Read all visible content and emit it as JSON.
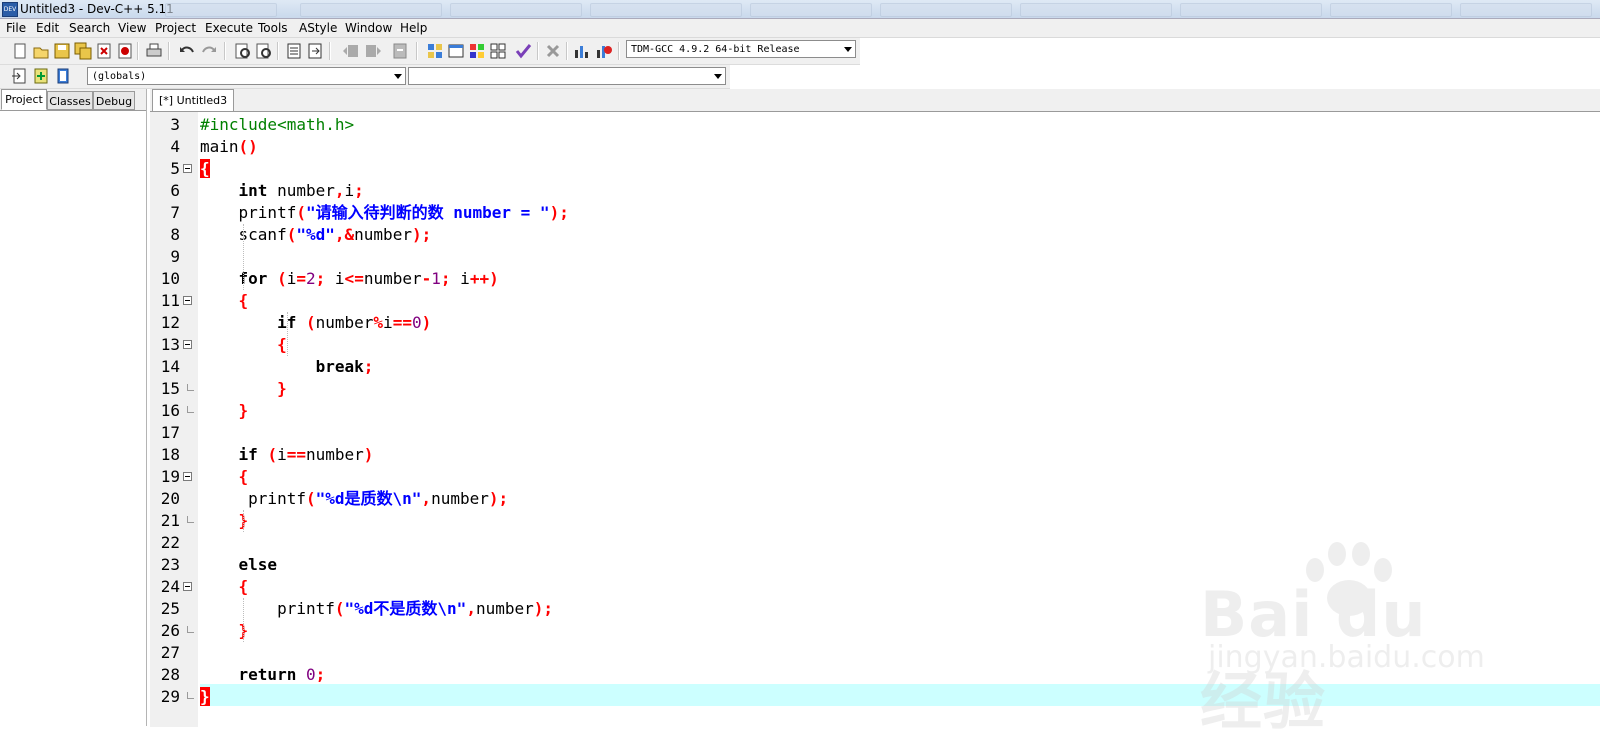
{
  "window": {
    "title": "Untitled3 - Dev-C++ 5.11"
  },
  "menu": [
    "File",
    "Edit",
    "Search",
    "View",
    "Project",
    "Execute",
    "Tools",
    "AStyle",
    "Window",
    "Help"
  ],
  "toolbar": {
    "compiler_select": "TDM-GCC 4.9.2 64-bit Release",
    "scope_select": "(globals)",
    "function_select": ""
  },
  "left_panel": {
    "tabs": [
      "Project",
      "Classes",
      "Debug"
    ],
    "active_tab": "Project"
  },
  "editor": {
    "tab_label": "[*] Untitled3",
    "current_line": 29,
    "lines": [
      {
        "n": "3",
        "text": "#include<math.h>"
      },
      {
        "n": "4",
        "text": "main()"
      },
      {
        "n": "5",
        "text": "{"
      },
      {
        "n": "6",
        "text": "    int number,i;"
      },
      {
        "n": "7",
        "text": "    printf(\"请输入待判断的数 number = \");"
      },
      {
        "n": "8",
        "text": "    scanf(\"%d\",&number);"
      },
      {
        "n": "9",
        "text": ""
      },
      {
        "n": "10",
        "text": "    for (i=2; i<=number-1; i++)"
      },
      {
        "n": "11",
        "text": "    {"
      },
      {
        "n": "12",
        "text": "        if (number%i==0)"
      },
      {
        "n": "13",
        "text": "        {"
      },
      {
        "n": "14",
        "text": "            break;"
      },
      {
        "n": "15",
        "text": "        }"
      },
      {
        "n": "16",
        "text": "    }"
      },
      {
        "n": "17",
        "text": ""
      },
      {
        "n": "18",
        "text": "    if (i==number)"
      },
      {
        "n": "19",
        "text": "    {"
      },
      {
        "n": "20",
        "text": "     printf(\"%d是质数\\n\",number);"
      },
      {
        "n": "21",
        "text": "    }"
      },
      {
        "n": "22",
        "text": ""
      },
      {
        "n": "23",
        "text": "    else"
      },
      {
        "n": "24",
        "text": "    {"
      },
      {
        "n": "25",
        "text": "        printf(\"%d不是质数\\n\",number);"
      },
      {
        "n": "26",
        "text": "    }"
      },
      {
        "n": "27",
        "text": ""
      },
      {
        "n": "28",
        "text": "    return 0;"
      },
      {
        "n": "29",
        "text": "}"
      }
    ]
  },
  "watermark": {
    "brand": "Bai du 经验",
    "url": "jingyan.baidu.com"
  },
  "colors": {
    "preprocessor": "#008000",
    "symbol": "#ff0000",
    "string": "#0000ff",
    "number": "#800080",
    "current_line": "#ccffff"
  }
}
